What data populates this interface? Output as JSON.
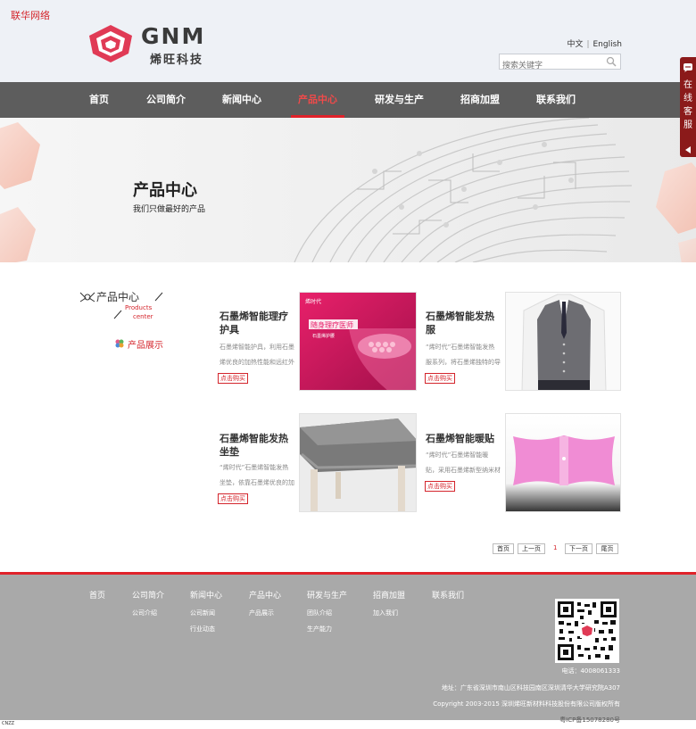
{
  "site": {
    "corner_link": "联华网络",
    "logo_en": "GNM",
    "logo_cn": "烯旺科技",
    "lang_cn": "中文",
    "lang_sep": "|",
    "lang_en": "English",
    "search_placeholder": "搜索关键字"
  },
  "nav": [
    "首页",
    "公司简介",
    "新闻中心",
    "产品中心",
    "研发与生产",
    "招商加盟",
    "联系我们"
  ],
  "banner": {
    "title": "产品中心",
    "subtitle": "我们只做最好的产品"
  },
  "side": {
    "title": "产品中心",
    "en1": "Products",
    "en2": "center",
    "item": "产品展示"
  },
  "products": [
    {
      "title": "石墨烯智能理疗护具",
      "desc1": "石墨烯智能护具，利用石墨",
      "desc2": "烯优良的加热性能和远红外",
      "buy": "点击购买"
    },
    {
      "title": "石墨烯智能发热服",
      "desc1": "“烯时代”石墨烯智能发热",
      "desc2": "服系列，将石墨烯独特的导",
      "buy": "点击购买"
    },
    {
      "title": "石墨烯智能发热坐垫",
      "desc1": "“烯时代”石墨烯智能发热",
      "desc2": "坐垫，依靠石墨烯优良的加",
      "buy": "点击购买"
    },
    {
      "title": "石墨烯智能暖贴",
      "desc1": "“烯时代”石墨烯智能暖",
      "desc2": "贴，采用石墨烯新型纳米材",
      "buy": "点击购买"
    }
  ],
  "product_img_text": {
    "brand": "烯时代",
    "headline": "随身理疗医师",
    "tag": "石墨烯护腰"
  },
  "pager": {
    "first": "首页",
    "prev": "上一页",
    "current": "1",
    "next": "下一页",
    "last": "尾页"
  },
  "footer": {
    "cols": [
      {
        "head": "首页",
        "subs": []
      },
      {
        "head": "公司简介",
        "subs": [
          "公司介绍"
        ]
      },
      {
        "head": "新闻中心",
        "subs": [
          "公司新闻",
          "行业动态"
        ]
      },
      {
        "head": "产品中心",
        "subs": [
          "产品展示"
        ]
      },
      {
        "head": "研发与生产",
        "subs": [
          "团队介绍",
          "生产能力"
        ]
      },
      {
        "head": "招商加盟",
        "subs": [
          "加入我们"
        ]
      },
      {
        "head": "联系我们",
        "subs": []
      }
    ],
    "phone": "电话：4008061333",
    "address": "地址：广东省深圳市南山区科技园南区深圳清华大学研究院A307",
    "copyright": "Copyright 2003-2015 深圳烯旺新材料科技股份有限公司版权所有",
    "icp": "粤ICP备15078280号"
  },
  "service": {
    "label": "在线客服"
  },
  "cnzz": "CNZZ",
  "colors": {
    "accent": "#e0222a",
    "nav_bg": "#5d5d5d",
    "footer_bg": "#a9a9a9",
    "header_bg": "#eef1f6"
  }
}
